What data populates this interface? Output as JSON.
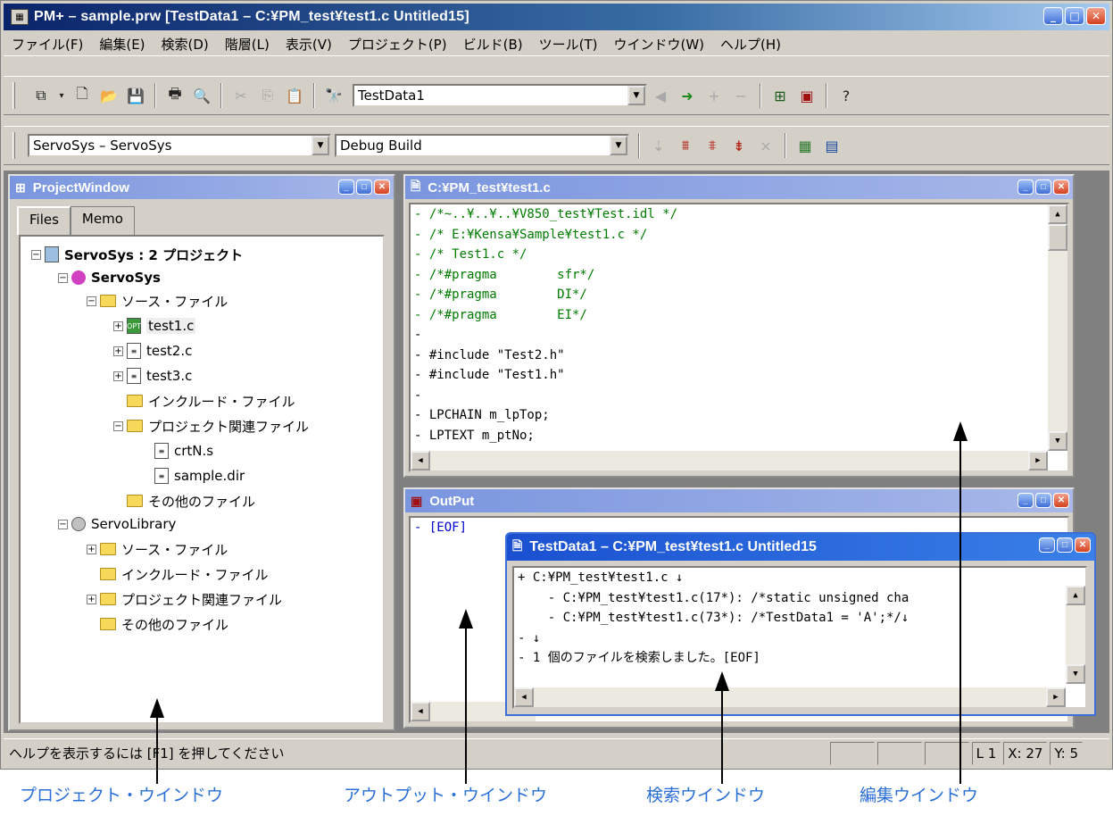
{
  "window": {
    "title": "PM+ – sample.prw [TestData1 – C:¥PM_test¥test1.c Untitled15]"
  },
  "menu": [
    "ファイル(F)",
    "編集(E)",
    "検索(D)",
    "階層(L)",
    "表示(V)",
    "プロジェクト(P)",
    "ビルド(B)",
    "ツール(T)",
    "ウインドウ(W)",
    "ヘルプ(H)"
  ],
  "toolbar1": {
    "search_combo": "TestData1"
  },
  "toolbar2": {
    "project_combo": "ServoSys – ServoSys",
    "build_combo": "Debug Build"
  },
  "project_window": {
    "title": "ProjectWindow",
    "tabs": [
      "Files",
      "Memo"
    ],
    "tree": [
      {
        "label": "ServoSys : 2 プロジェクト",
        "bold": true
      },
      {
        "label": "ServoSys",
        "bold": true
      },
      {
        "label": "ソース・ファイル"
      },
      {
        "label": "test1.c"
      },
      {
        "label": "test2.c"
      },
      {
        "label": "test3.c"
      },
      {
        "label": "インクルード・ファイル"
      },
      {
        "label": "プロジェクト関連ファイル"
      },
      {
        "label": "crtN.s"
      },
      {
        "label": "sample.dir"
      },
      {
        "label": "その他のファイル"
      },
      {
        "label": "ServoLibrary"
      },
      {
        "label": "ソース・ファイル"
      },
      {
        "label": "インクルード・ファイル"
      },
      {
        "label": "プロジェクト関連ファイル"
      },
      {
        "label": "その他のファイル"
      }
    ]
  },
  "editor_window": {
    "title": "C:¥PM_test¥test1.c",
    "lines": [
      "- /*~..¥..¥..¥V850_test¥Test.idl */",
      "- /* E:¥Kensa¥Sample¥test1.c */",
      "- /* Test1.c */",
      "- /*#pragma        sfr*/",
      "- /*#pragma        DI*/",
      "- /*#pragma        EI*/",
      "- ",
      "- #include \"Test2.h\"",
      "- #include \"Test1.h\"",
      "- ",
      "- LPCHAIN m_lpTop;",
      "- LPTEXT m_ptNo;"
    ],
    "eol_mark": "↓"
  },
  "output_window": {
    "title": "OutPut",
    "lines": [
      "- [EOF]"
    ]
  },
  "search_window": {
    "title": "TestData1 – C:¥PM_test¥test1.c Untitled15",
    "lines": [
      "+ C:¥PM_test¥test1.c ↓",
      "    - C:¥PM_test¥test1.c(17*): /*static unsigned cha",
      "    - C:¥PM_test¥test1.c(73*): /*TestData1 = 'A';*/↓",
      "- ↓",
      "- 1 個のファイルを検索しました。[EOF]"
    ]
  },
  "statusbar": {
    "message": "ヘルプを表示するには [F1] を押してください",
    "line": "L 1",
    "x": "X: 27",
    "y": "Y: 5"
  },
  "callouts": [
    "プロジェクト・ウインドウ",
    "アウトプット・ウインドウ",
    "検索ウインドウ",
    "編集ウインドウ"
  ]
}
